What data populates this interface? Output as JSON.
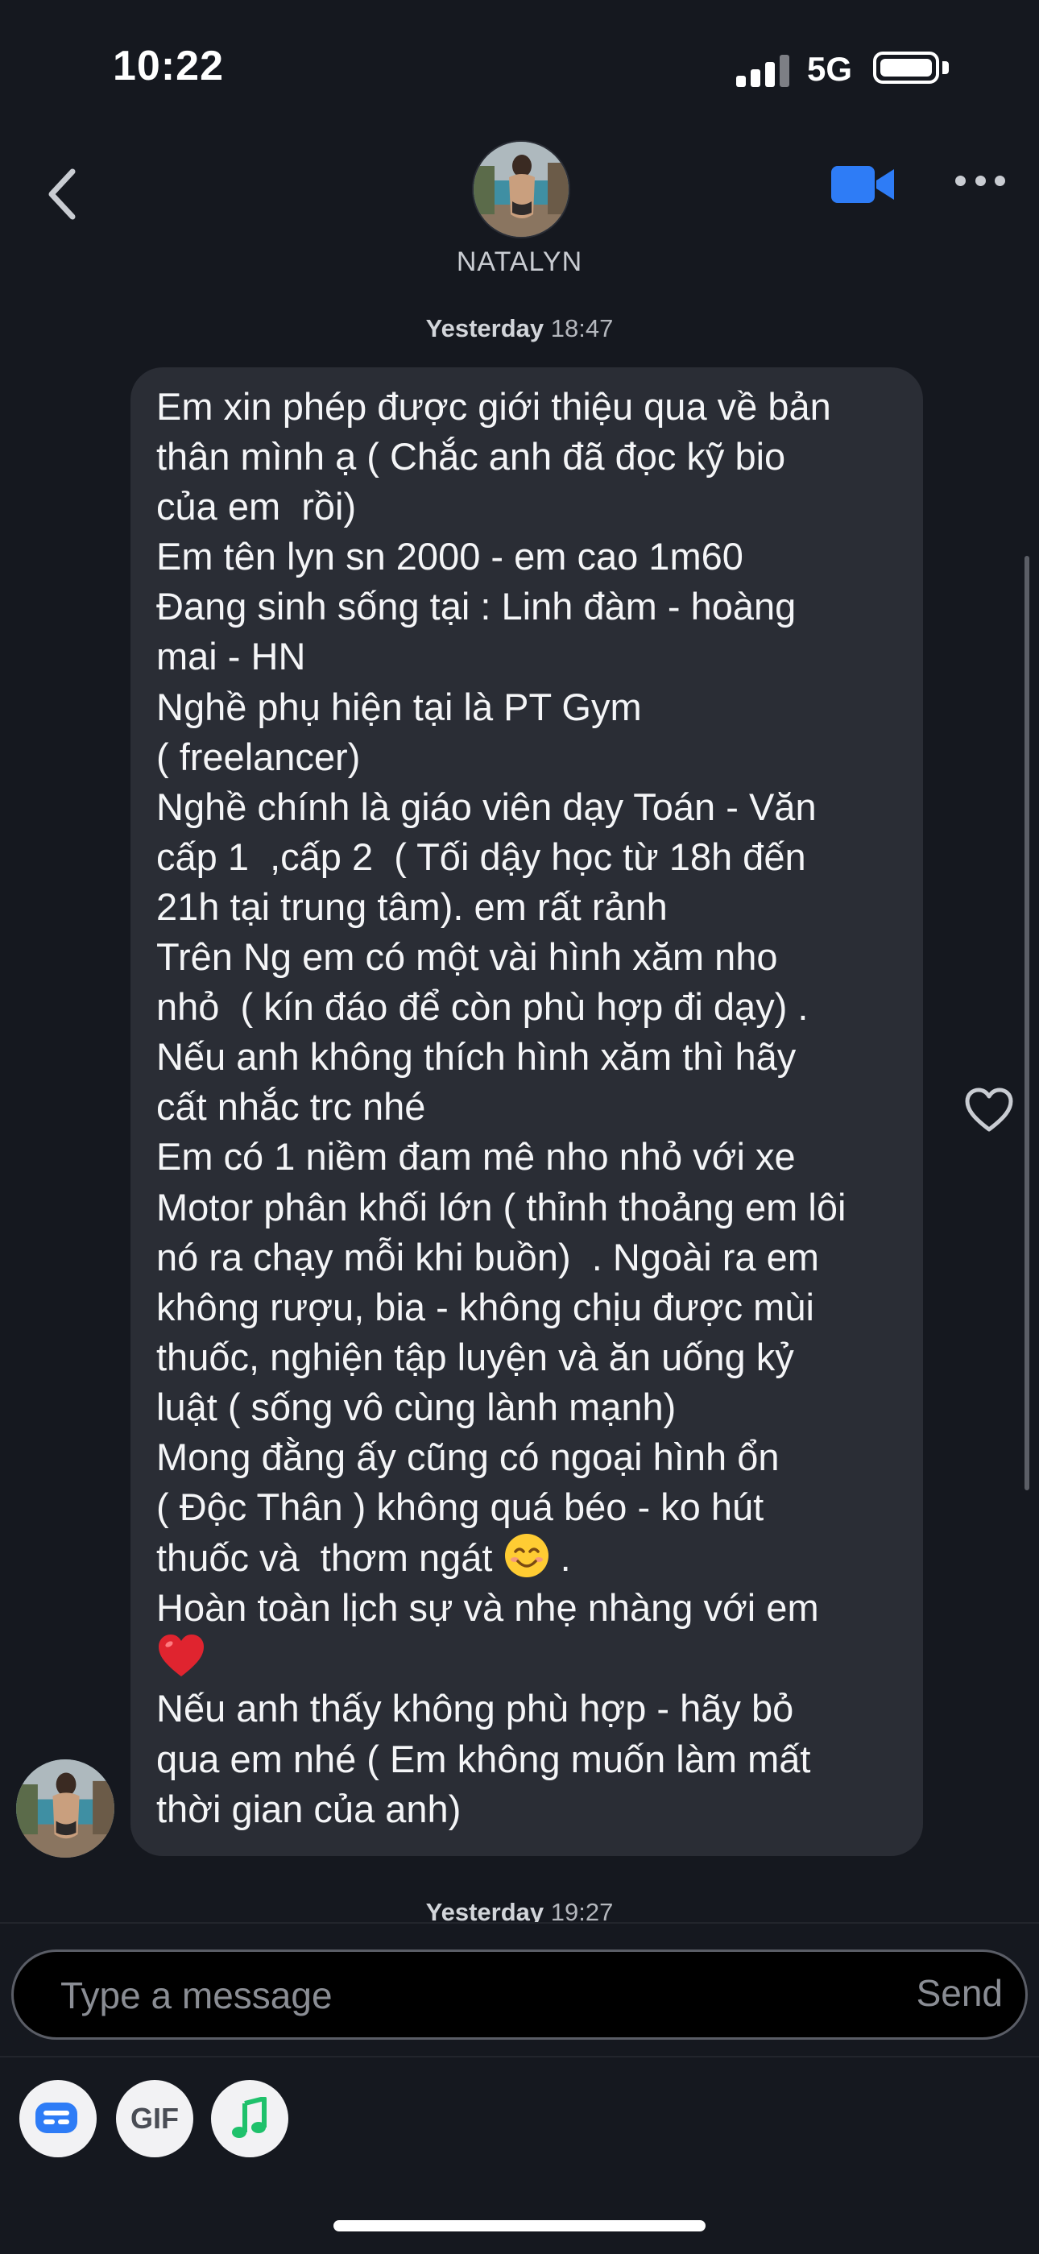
{
  "status_bar": {
    "time": "10:22",
    "network": "5G",
    "signal_bars": 3,
    "battery_level": 0.95
  },
  "header": {
    "contact_name": "NATALYN",
    "back_icon": "chevron-left-icon",
    "video_icon": "video-camera-icon",
    "more_icon": "ellipsis-icon"
  },
  "messages": [
    {
      "day": "Yesterday",
      "time": "18:47",
      "lines": [
        "Em xin phép được giới thiệu qua về bản",
        "thân mình ạ ( Chắc anh đã đọc kỹ bio",
        "của em  rồi)",
        "Em tên lyn sn 2000 - em cao 1m60",
        "Đang sinh sống tại : Linh đàm - hoàng",
        "mai - HN",
        "Nghề phụ hiện tại là PT Gym",
        "( freelancer)",
        "Nghề chính là giáo viên dạy Toán - Văn",
        "cấp 1  ,cấp 2  ( Tối dậy học từ 18h đến",
        "21h tại trung tâm). em rất rảnh",
        "Trên Ng em có một vài hình xăm nho",
        "nhỏ  ( kín đáo để còn phù hợp đi dạy) .",
        "Nếu anh không thích hình xăm thì hãy",
        "cất nhắc trc nhé",
        "Em có 1 niềm đam mê nho nhỏ với xe",
        "Motor phân khối lớn ( thỉnh thoảng em lôi",
        "nó ra chạy mỗi khi buồn)  . Ngoài ra em",
        "không rượu, bia - không chịu được mùi",
        "thuốc, nghiện tập luyện và ăn uống kỷ",
        "luật ( sống vô cùng lành mạnh)",
        "Mong đằng ấy cũng có ngoại hình ổn",
        "( Độc Thân ) không quá béo - ko hút",
        "thuốc và  thơm ngát ",
        "Hoàn toàn lịch sự và nhẹ nhàng với em",
        "",
        "Nếu anh thấy không phù hợp - hãy bỏ",
        "qua em nhé ( Em không muốn làm mất",
        "thời gian của anh)"
      ],
      "line23_suffix": " .",
      "emojis": [
        "smiling-face-emoji",
        "red-heart-emoji"
      ],
      "liked": false
    },
    {
      "day": "Yesterday",
      "time": "19:27"
    }
  ],
  "composer": {
    "placeholder": "Type a message",
    "send_label": "Send"
  },
  "toolbar": {
    "sticker_icon": "sticker-icon",
    "gif_label": "GIF",
    "music_icon": "music-note-icon"
  },
  "colors": {
    "accent": "#2e7cf6",
    "bubble": "#2a2d35",
    "background": "#15181f",
    "music_green": "#1fc16b"
  }
}
